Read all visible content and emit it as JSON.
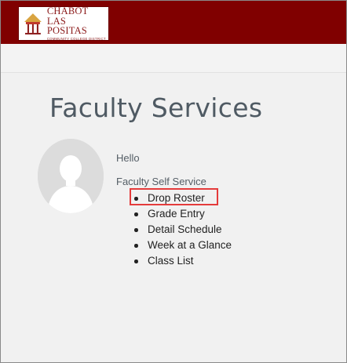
{
  "header": {
    "logo": {
      "line1": "CHABOT",
      "line2": "LAS POSITAS",
      "line3": "COMMUNITY COLLEGE DISTRICT"
    },
    "bar_color": "#800000"
  },
  "page": {
    "title": "Faculty Services",
    "greeting": "Hello",
    "section_label": "Faculty Self Service"
  },
  "menu": {
    "items": [
      {
        "label": "Drop Roster",
        "highlighted": true
      },
      {
        "label": "Grade Entry"
      },
      {
        "label": "Detail Schedule"
      },
      {
        "label": "Week at a Glance"
      },
      {
        "label": "Class List"
      }
    ]
  },
  "colors": {
    "highlight_border": "#e43b3b",
    "title_text": "#4f5a63"
  },
  "icons": {
    "logo": "college-building-icon",
    "avatar": "person-silhouette-icon"
  }
}
